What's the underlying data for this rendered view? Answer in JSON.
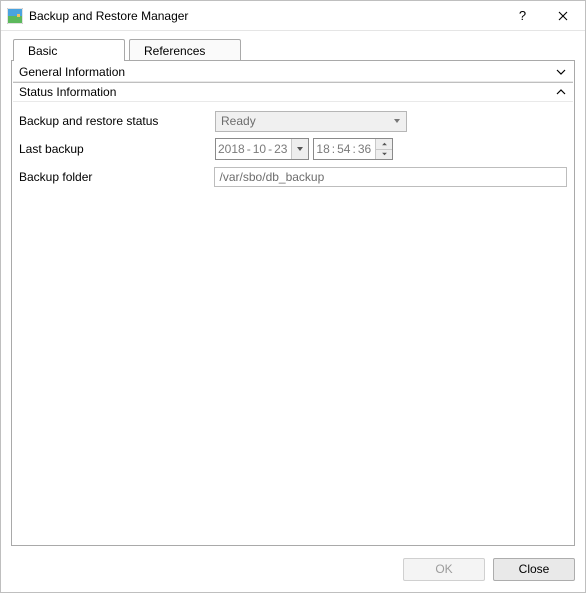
{
  "window": {
    "title": "Backup and Restore Manager"
  },
  "tabs": {
    "basic": "Basic",
    "references": "References"
  },
  "sections": {
    "general": "General Information",
    "status": "Status Information"
  },
  "labels": {
    "status": "Backup and restore status",
    "last_backup": "Last backup",
    "folder": "Backup folder"
  },
  "values": {
    "status": "Ready",
    "date_y": "2018",
    "date_m": "10",
    "date_d": "23",
    "time_h": "18",
    "time_m": "54",
    "time_s": "36",
    "folder": "/var/sbo/db_backup"
  },
  "buttons": {
    "ok": "OK",
    "close": "Close"
  }
}
